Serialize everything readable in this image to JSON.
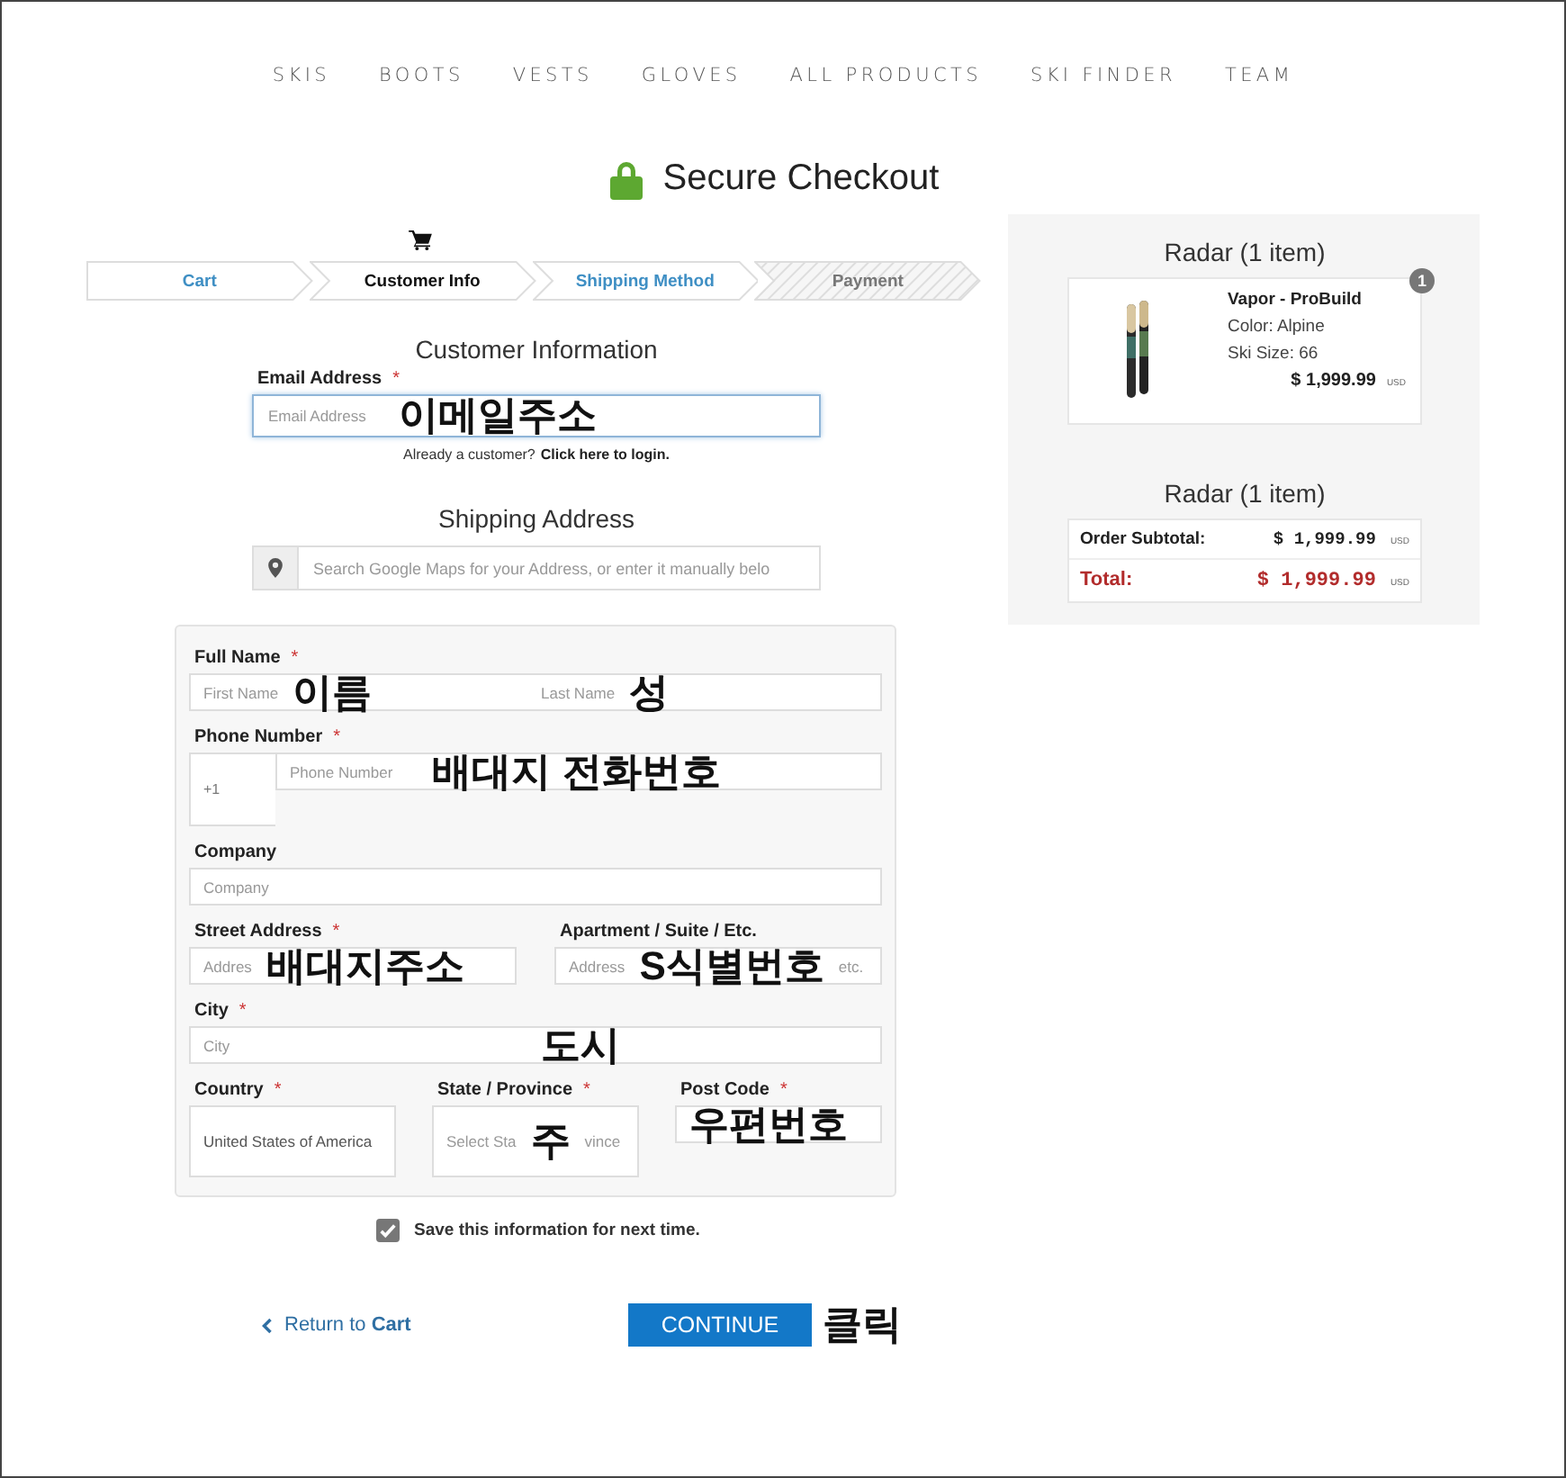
{
  "nav": [
    "SKIS",
    "BOOTS",
    "VESTS",
    "GLOVES",
    "ALL PRODUCTS",
    "SKI FINDER",
    "TEAM"
  ],
  "title": "Secure Checkout",
  "steps": [
    {
      "label": "Cart",
      "kind": "link"
    },
    {
      "label": "Customer Info",
      "kind": "current"
    },
    {
      "label": "Shipping Method",
      "kind": "link"
    },
    {
      "label": "Payment",
      "kind": "locked"
    }
  ],
  "customer": {
    "heading": "Customer Information",
    "email_label": "Email Address",
    "email_required": "*",
    "email_placeholder": "Email Address",
    "email_annotation": "이메일주소",
    "login_prompt": "Already a customer?",
    "login_link": "Click here to login."
  },
  "shipping": {
    "heading": "Shipping Address",
    "search_placeholder": "Search Google Maps for your Address, or enter it manually belo"
  },
  "address_rows": [
    [
      {
        "label": "Full Name",
        "required": "*",
        "kind": "input",
        "segments": [
          [
            {
              "kind": "text",
              "text": "First Name"
            },
            {
              "kind": "note",
              "text": "이름"
            }
          ],
          [
            {
              "kind": "text",
              "text": "Last Name"
            },
            {
              "kind": "note",
              "text": "성"
            }
          ]
        ]
      }
    ],
    [
      {
        "label": "Phone Number",
        "required": "*",
        "kind": "phone",
        "prefix": "+1",
        "segments": [
          [
            {
              "kind": "text",
              "text": "Phone Number"
            },
            {
              "kind": "note",
              "text": "배대지 전화번호"
            }
          ]
        ]
      }
    ],
    [
      {
        "label": "Company",
        "kind": "input",
        "segments": [
          [
            {
              "kind": "text",
              "text": "Company"
            }
          ]
        ]
      }
    ],
    [
      {
        "label": "Street Address",
        "required": "*",
        "kind": "input",
        "segments": [
          [
            {
              "kind": "text",
              "text": "Addres"
            },
            {
              "kind": "note",
              "text": "배대지주소"
            }
          ]
        ]
      },
      {
        "label": "Apartment / Suite / Etc.",
        "kind": "input",
        "segments": [
          [
            {
              "kind": "text",
              "text": "Address"
            },
            {
              "kind": "note",
              "text": "S식별번호"
            },
            {
              "kind": "text",
              "text": "etc."
            }
          ]
        ]
      }
    ],
    [
      {
        "label": "City",
        "required": "*",
        "kind": "input",
        "segments": [
          [
            {
              "kind": "text",
              "text": "City"
            }
          ],
          [
            {
              "kind": "note",
              "text": "도시"
            }
          ]
        ]
      }
    ],
    [
      {
        "label": "Country",
        "required": "*",
        "kind": "select",
        "segments": [
          [
            {
              "kind": "value",
              "text": "United States of America"
            }
          ]
        ]
      },
      {
        "label": "State / Province",
        "required": "*",
        "kind": "select",
        "segments": [
          [
            {
              "kind": "text",
              "text": "Select Sta"
            },
            {
              "kind": "note",
              "text": "주"
            },
            {
              "kind": "text",
              "text": "vince"
            }
          ]
        ]
      },
      {
        "label": "Post Code",
        "required": "*",
        "kind": "input",
        "segments": [
          [
            {
              "kind": "note",
              "text": "우편번호"
            }
          ]
        ]
      }
    ]
  ],
  "save_info": {
    "label": "Save this information for next time.",
    "checked": true
  },
  "back_link": "Return to **Cart**",
  "continue": {
    "label": "CONTINUE",
    "annotation": "클릭"
  },
  "summary": {
    "title": "Radar (1 item)",
    "items": [
      {
        "name": "Vapor - ProBuild",
        "details": [
          "Color: Alpine",
          "Ski Size: 66"
        ],
        "price": "$ 1,999.99",
        "currency": "USD",
        "quantity": "1"
      }
    ]
  },
  "totals": {
    "title": "Radar (1 item)",
    "rows": [
      {
        "label": "Order Subtotal:",
        "value": "$ 1,999.99",
        "currency": "USD",
        "kind": "subtotal"
      },
      {
        "label": "Total:",
        "value": "$ 1,999.99",
        "currency": "USD",
        "kind": "total"
      }
    ]
  }
}
